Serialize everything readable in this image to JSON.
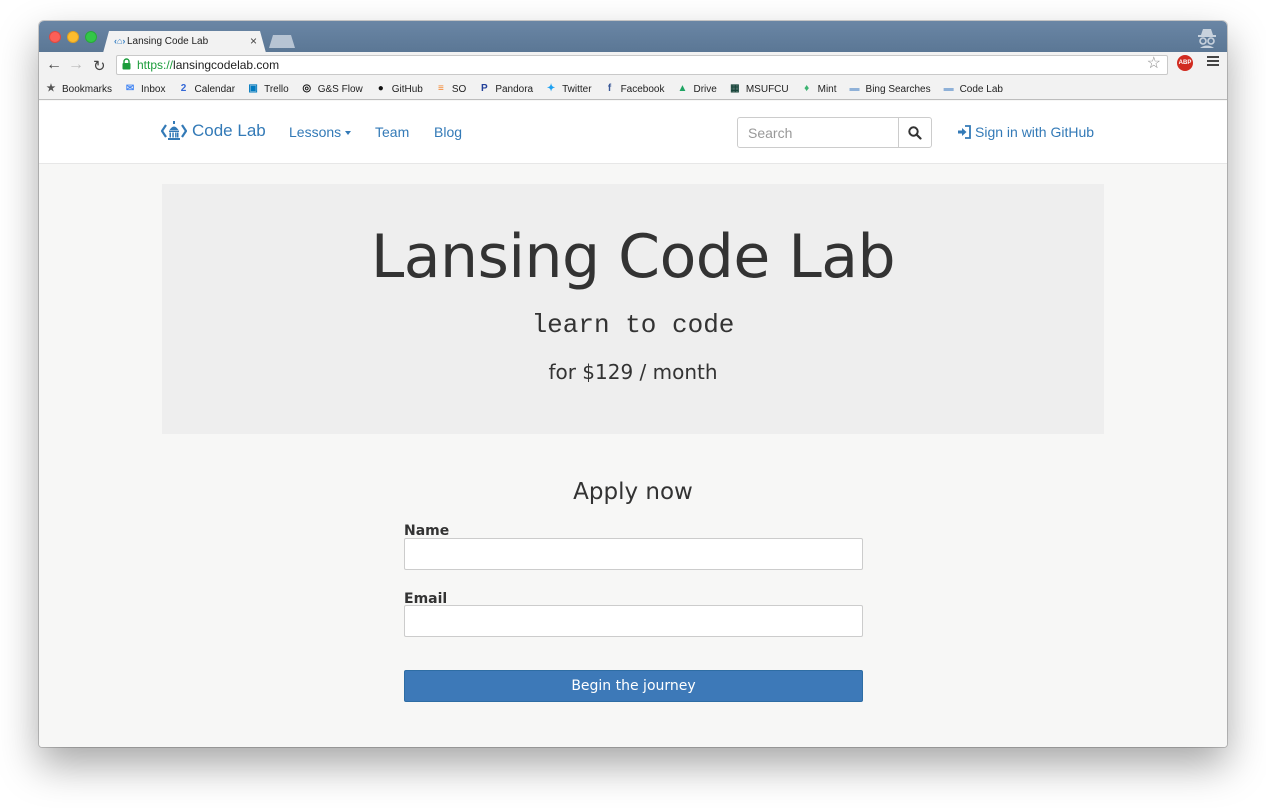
{
  "browser": {
    "tab_title": "Lansing Code Lab",
    "tab_close": "×",
    "url_scheme": "https://",
    "url_host": "lansingcodelab.com",
    "star_icon": "☆",
    "abp_label": "ABP"
  },
  "bookmarks": [
    {
      "label": "Bookmarks",
      "icon": "★",
      "color": "#555555"
    },
    {
      "label": "Inbox",
      "icon": "✉",
      "color": "#4285f4"
    },
    {
      "label": "Calendar",
      "icon": "2",
      "color": "#3367d6"
    },
    {
      "label": "Trello",
      "icon": "▣",
      "color": "#0079bf"
    },
    {
      "label": "G&S Flow",
      "icon": "◎",
      "color": "#111111"
    },
    {
      "label": "GitHub",
      "icon": "●",
      "color": "#111111"
    },
    {
      "label": "SO",
      "icon": "≡",
      "color": "#f48024"
    },
    {
      "label": "Pandora",
      "icon": "P",
      "color": "#224099"
    },
    {
      "label": "Twitter",
      "icon": "✦",
      "color": "#1da1f2"
    },
    {
      "label": "Facebook",
      "icon": "f",
      "color": "#3b5998"
    },
    {
      "label": "Drive",
      "icon": "▲",
      "color": "#1fa463"
    },
    {
      "label": "MSUFCU",
      "icon": "▦",
      "color": "#18453b"
    },
    {
      "label": "Mint",
      "icon": "♦",
      "color": "#3cb371"
    },
    {
      "label": "Bing Searches",
      "icon": "▬",
      "color": "#8fb1d8"
    },
    {
      "label": "Code Lab",
      "icon": "▬",
      "color": "#8fb1d8"
    }
  ],
  "nav": {
    "brand": "Code Lab",
    "lessons": "Lessons",
    "team": "Team",
    "blog": "Blog",
    "search_placeholder": "Search",
    "signin": "Sign in with GitHub"
  },
  "hero": {
    "title": "Lansing Code Lab",
    "subtitle": "learn to code",
    "price": "for $129 / month"
  },
  "form": {
    "title": "Apply now",
    "name_label": "Name",
    "name_value": "",
    "email_label": "Email",
    "email_value": "",
    "submit": "Begin the journey"
  },
  "colors": {
    "link": "#337ab7",
    "primary_button": "#3d79b8",
    "jumbotron": "#eeeeee"
  }
}
